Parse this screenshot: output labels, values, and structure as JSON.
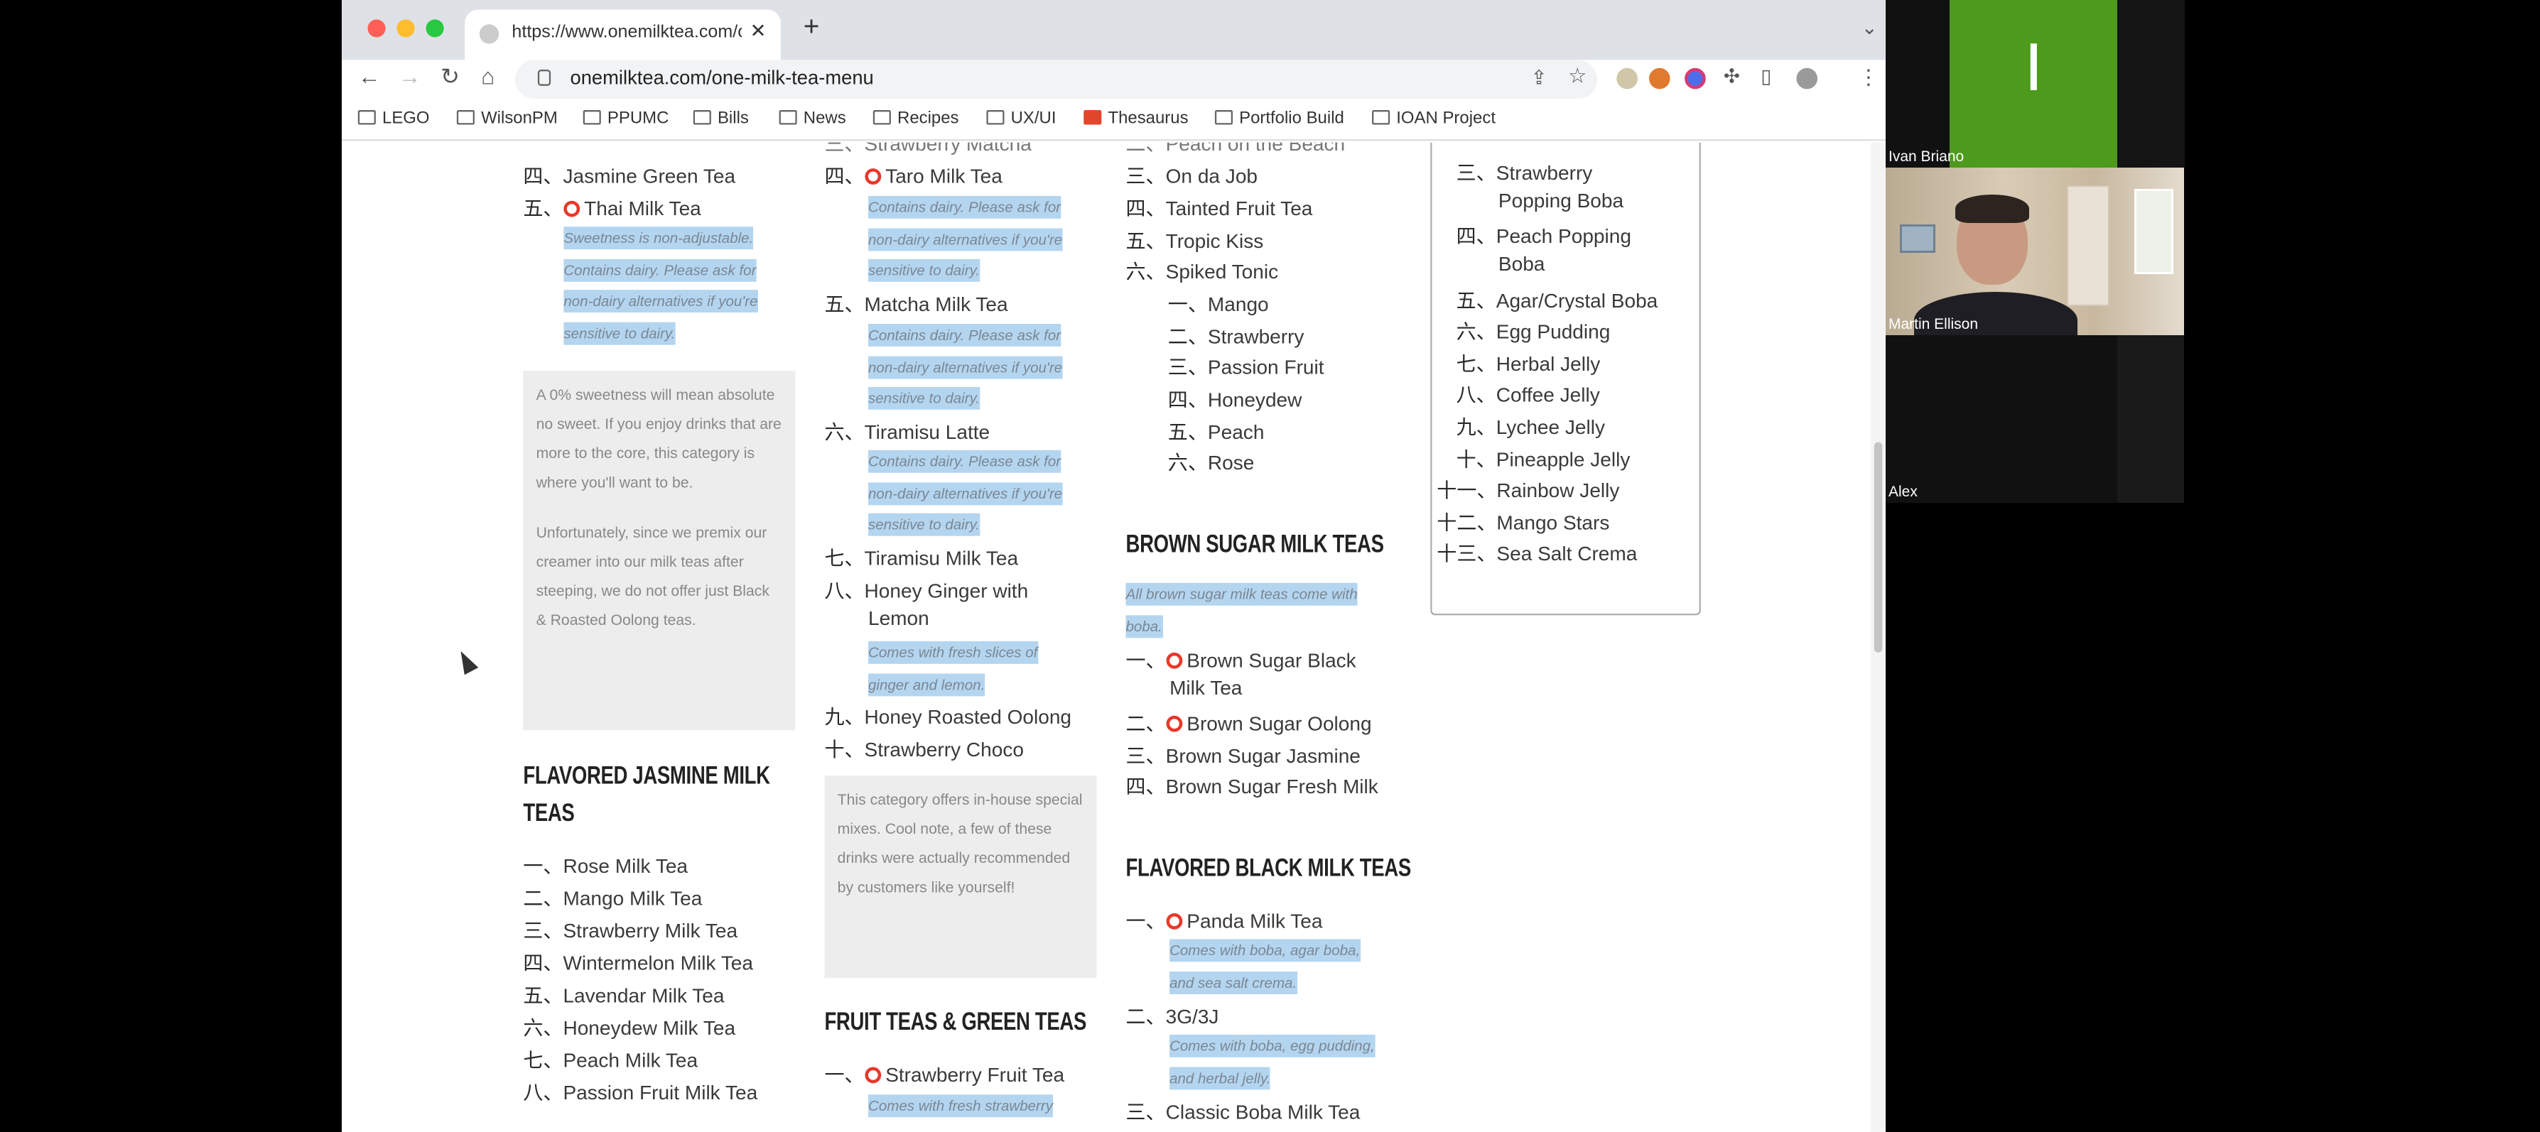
{
  "browser": {
    "tab_title": "https://www.onemilktea.com/o",
    "url": "onemilktea.com/one-milk-tea-menu",
    "bookmarks": [
      "LEGO",
      "WilsonPM",
      "PPUMC",
      "Bills",
      "News",
      "Recipes",
      "UX/UI",
      "Thesaurus",
      "Portfolio Build",
      "IOAN Project"
    ]
  },
  "menu": {
    "col1_top": [
      {
        "num": "四、",
        "name": "Jasmine Green Tea"
      },
      {
        "num": "五、",
        "name": "Thai Milk Tea"
      }
    ],
    "col1_note": [
      "Sweetness is non-adjustable.",
      "Contains dairy. Please ask for",
      "non-dairy alternatives if you're",
      "sensitive to dairy."
    ],
    "col1_info": [
      "A 0% sweetness will mean absolute no sweet. If you enjoy drinks that are more to the core, this category is where you'll want to be.",
      "Unfortunately, since we premix our creamer into our milk teas after steeping, we do not offer just Black & Roasted Oolong teas."
    ],
    "flavored_jasmine": {
      "heading_l1": "FLAVORED JASMINE MILK",
      "heading_l2": "TEAS",
      "items": [
        {
          "num": "一、",
          "name": "Rose Milk Tea"
        },
        {
          "num": "二、",
          "name": "Mango Milk Tea"
        },
        {
          "num": "三、",
          "name": "Strawberry Milk Tea"
        },
        {
          "num": "四、",
          "name": "Wintermelon Milk Tea"
        },
        {
          "num": "五、",
          "name": "Lavendar Milk Tea"
        },
        {
          "num": "六、",
          "name": "Honeydew Milk Tea"
        },
        {
          "num": "七、",
          "name": "Peach Milk Tea"
        },
        {
          "num": "八、",
          "name": "Passion Fruit Milk Tea"
        }
      ]
    },
    "col2": {
      "partial_top": "三、Strawberry Matcha",
      "taro": {
        "num": "四、",
        "name": "Taro Milk Tea"
      },
      "dairy_note": [
        "Contains dairy. Please ask for",
        "non-dairy alternatives if you're",
        "sensitive to dairy."
      ],
      "matcha": {
        "num": "五、",
        "name": "Matcha Milk Tea"
      },
      "tiramisu_latte": {
        "num": "六、",
        "name": "Tiramisu Latte"
      },
      "tiramisu_milk": {
        "num": "七、",
        "name": "Tiramisu Milk Tea"
      },
      "honey_ginger": {
        "num": "八、",
        "name": "Honey Ginger with",
        "name2": "Lemon"
      },
      "ginger_note": [
        "Comes with fresh slices of",
        "ginger and lemon."
      ],
      "honey_roasted": {
        "num": "九、",
        "name": "Honey Roasted Oolong"
      },
      "strawberry_choco": {
        "num": "十、",
        "name": "Strawberry Choco"
      },
      "info": "This category offers in-house special mixes. Cool note, a few of these drinks were actually recommended by customers like yourself!",
      "fruit_heading": "FRUIT TEAS & GREEN TEAS",
      "strawberry_fruit": {
        "num": "一、",
        "name": "Strawberry Fruit Tea"
      },
      "fruit_note": "Comes with fresh strawberry"
    },
    "col3": {
      "partial_top": "二、Peach on the Beach",
      "items": [
        {
          "num": "三、",
          "name": "On da Job"
        },
        {
          "num": "四、",
          "name": "Tainted Fruit Tea"
        },
        {
          "num": "五、",
          "name": "Tropic Kiss"
        },
        {
          "num": "六、",
          "name": "Spiked Tonic"
        }
      ],
      "sub": [
        {
          "num": "一、",
          "name": "Mango"
        },
        {
          "num": "二、",
          "name": "Strawberry"
        },
        {
          "num": "三、",
          "name": "Passion Fruit"
        },
        {
          "num": "四、",
          "name": "Honeydew"
        },
        {
          "num": "五、",
          "name": "Peach"
        },
        {
          "num": "六、",
          "name": "Rose"
        }
      ],
      "brown_heading": "BROWN SUGAR MILK TEAS",
      "brown_note": [
        "All brown sugar milk teas come with",
        "boba."
      ],
      "bs1": {
        "num": "一、",
        "name": "Brown Sugar Black",
        "name2": "Milk Tea"
      },
      "bs2": {
        "num": "二、",
        "name": "Brown Sugar Oolong"
      },
      "bs3": {
        "num": "三、",
        "name": "Brown Sugar Jasmine"
      },
      "bs4": {
        "num": "四、",
        "name": "Brown Sugar Fresh Milk"
      },
      "flavored_black_heading": "FLAVORED BLACK MILK TEAS",
      "panda": {
        "num": "一、",
        "name": "Panda Milk Tea"
      },
      "panda_note": [
        "Comes with boba, agar boba,",
        "and sea salt crema."
      ],
      "g3": {
        "num": "二、",
        "name": "3G/3J"
      },
      "g3_note": [
        "Comes with boba, egg pudding,",
        "and herbal jelly."
      ],
      "classic": {
        "num": "三、",
        "name": "Classic Boba Milk Tea"
      }
    },
    "toppings": [
      {
        "num": "三、",
        "name": "Strawberry",
        "name2": "Popping Boba"
      },
      {
        "num": "四、",
        "name": "Peach Popping",
        "name2": "Boba"
      },
      {
        "num": "五、",
        "name": "Agar/Crystal Boba"
      },
      {
        "num": "六、",
        "name": "Egg Pudding"
      },
      {
        "num": "七、",
        "name": "Herbal Jelly"
      },
      {
        "num": "八、",
        "name": "Coffee Jelly"
      },
      {
        "num": "九、",
        "name": "Lychee Jelly"
      },
      {
        "num": "十、",
        "name": "Pineapple Jelly"
      },
      {
        "num": "十一、",
        "name": "Rainbow Jelly"
      },
      {
        "num": "十二、",
        "name": "Mango Stars"
      },
      {
        "num": "十三、",
        "name": "Sea Salt Crema"
      }
    ]
  },
  "meeting": {
    "participants": [
      {
        "name": "Ivan Briano",
        "initial": "I"
      },
      {
        "name": "Martin Ellison"
      },
      {
        "name": "Alex"
      }
    ]
  },
  "colors": {
    "ivan_tile": "#4d9a1c",
    "highlight": "#b4d5ef",
    "accent_fire": "#e8382b"
  }
}
